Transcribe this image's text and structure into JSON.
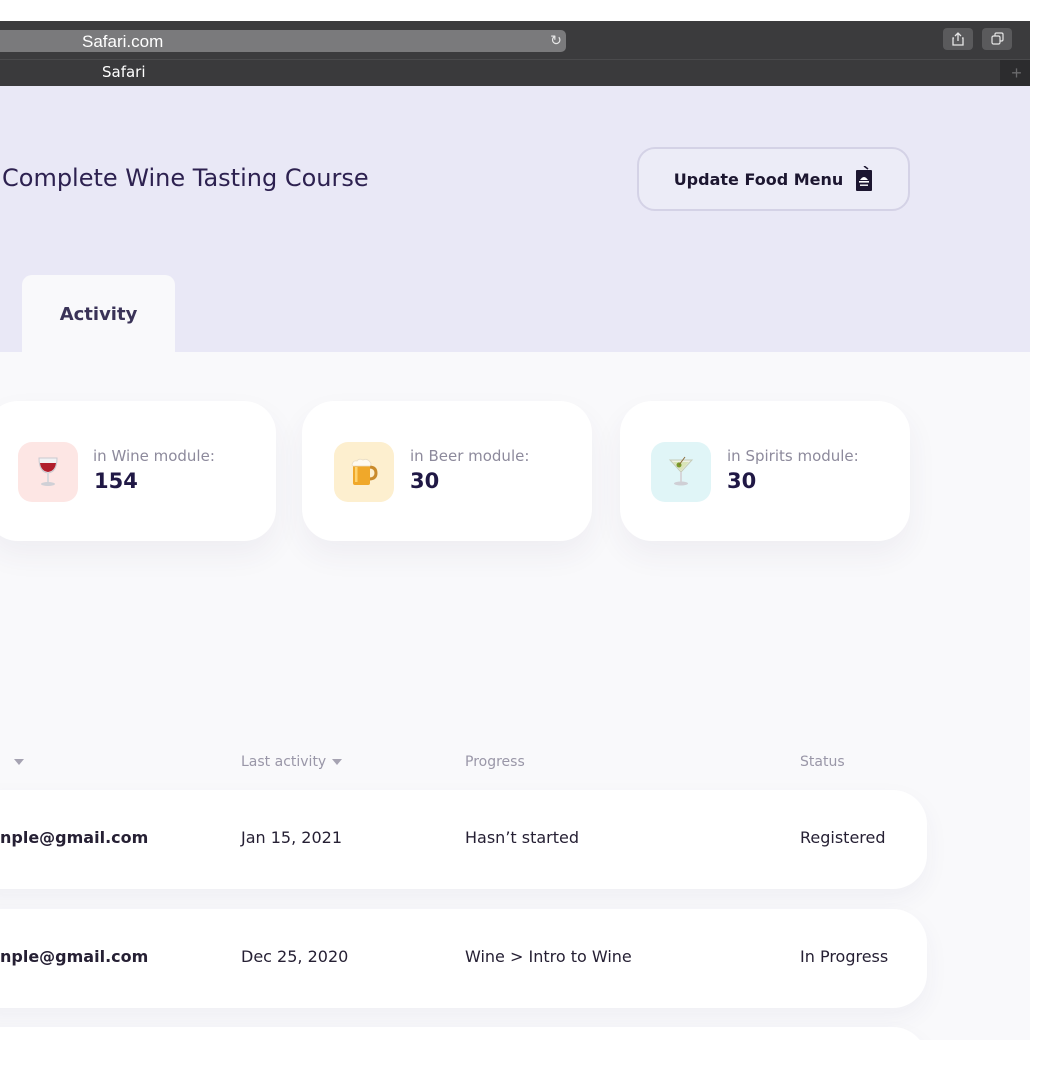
{
  "browser": {
    "address": "Safari.com",
    "tab_title": "Safari",
    "new_tab": "+"
  },
  "header": {
    "title": "Complete Wine Tasting Course",
    "update_button": "Update Food Menu"
  },
  "tabs": {
    "activity": "Activity"
  },
  "stats": [
    {
      "label": "in Wine module:",
      "value": "154",
      "icon": "wine-glass-icon",
      "bg": "#fde6e4"
    },
    {
      "label": "in Beer module:",
      "value": "30",
      "icon": "beer-mug-icon",
      "bg": "#fdefcf"
    },
    {
      "label": "in Spirits module:",
      "value": "30",
      "icon": "cocktail-glass-icon",
      "bg": "#e0f5f7"
    }
  ],
  "table": {
    "columns": [
      "",
      "Last activity",
      "Progress",
      "Status"
    ],
    "rows": [
      {
        "email": "nple@gmail.com",
        "last_activity": "Jan 15, 2021",
        "progress": "Hasn’t started",
        "status": "Registered"
      },
      {
        "email": "nple@gmail.com",
        "last_activity": "Dec 25, 2020",
        "progress": "Wine > Intro to Wine",
        "status": "In Progress"
      }
    ]
  },
  "colors": {
    "header_bg": "#e9e8f6",
    "page_bg": "#f9f9fb",
    "title": "#2d2150",
    "accent_dark": "#201845"
  }
}
